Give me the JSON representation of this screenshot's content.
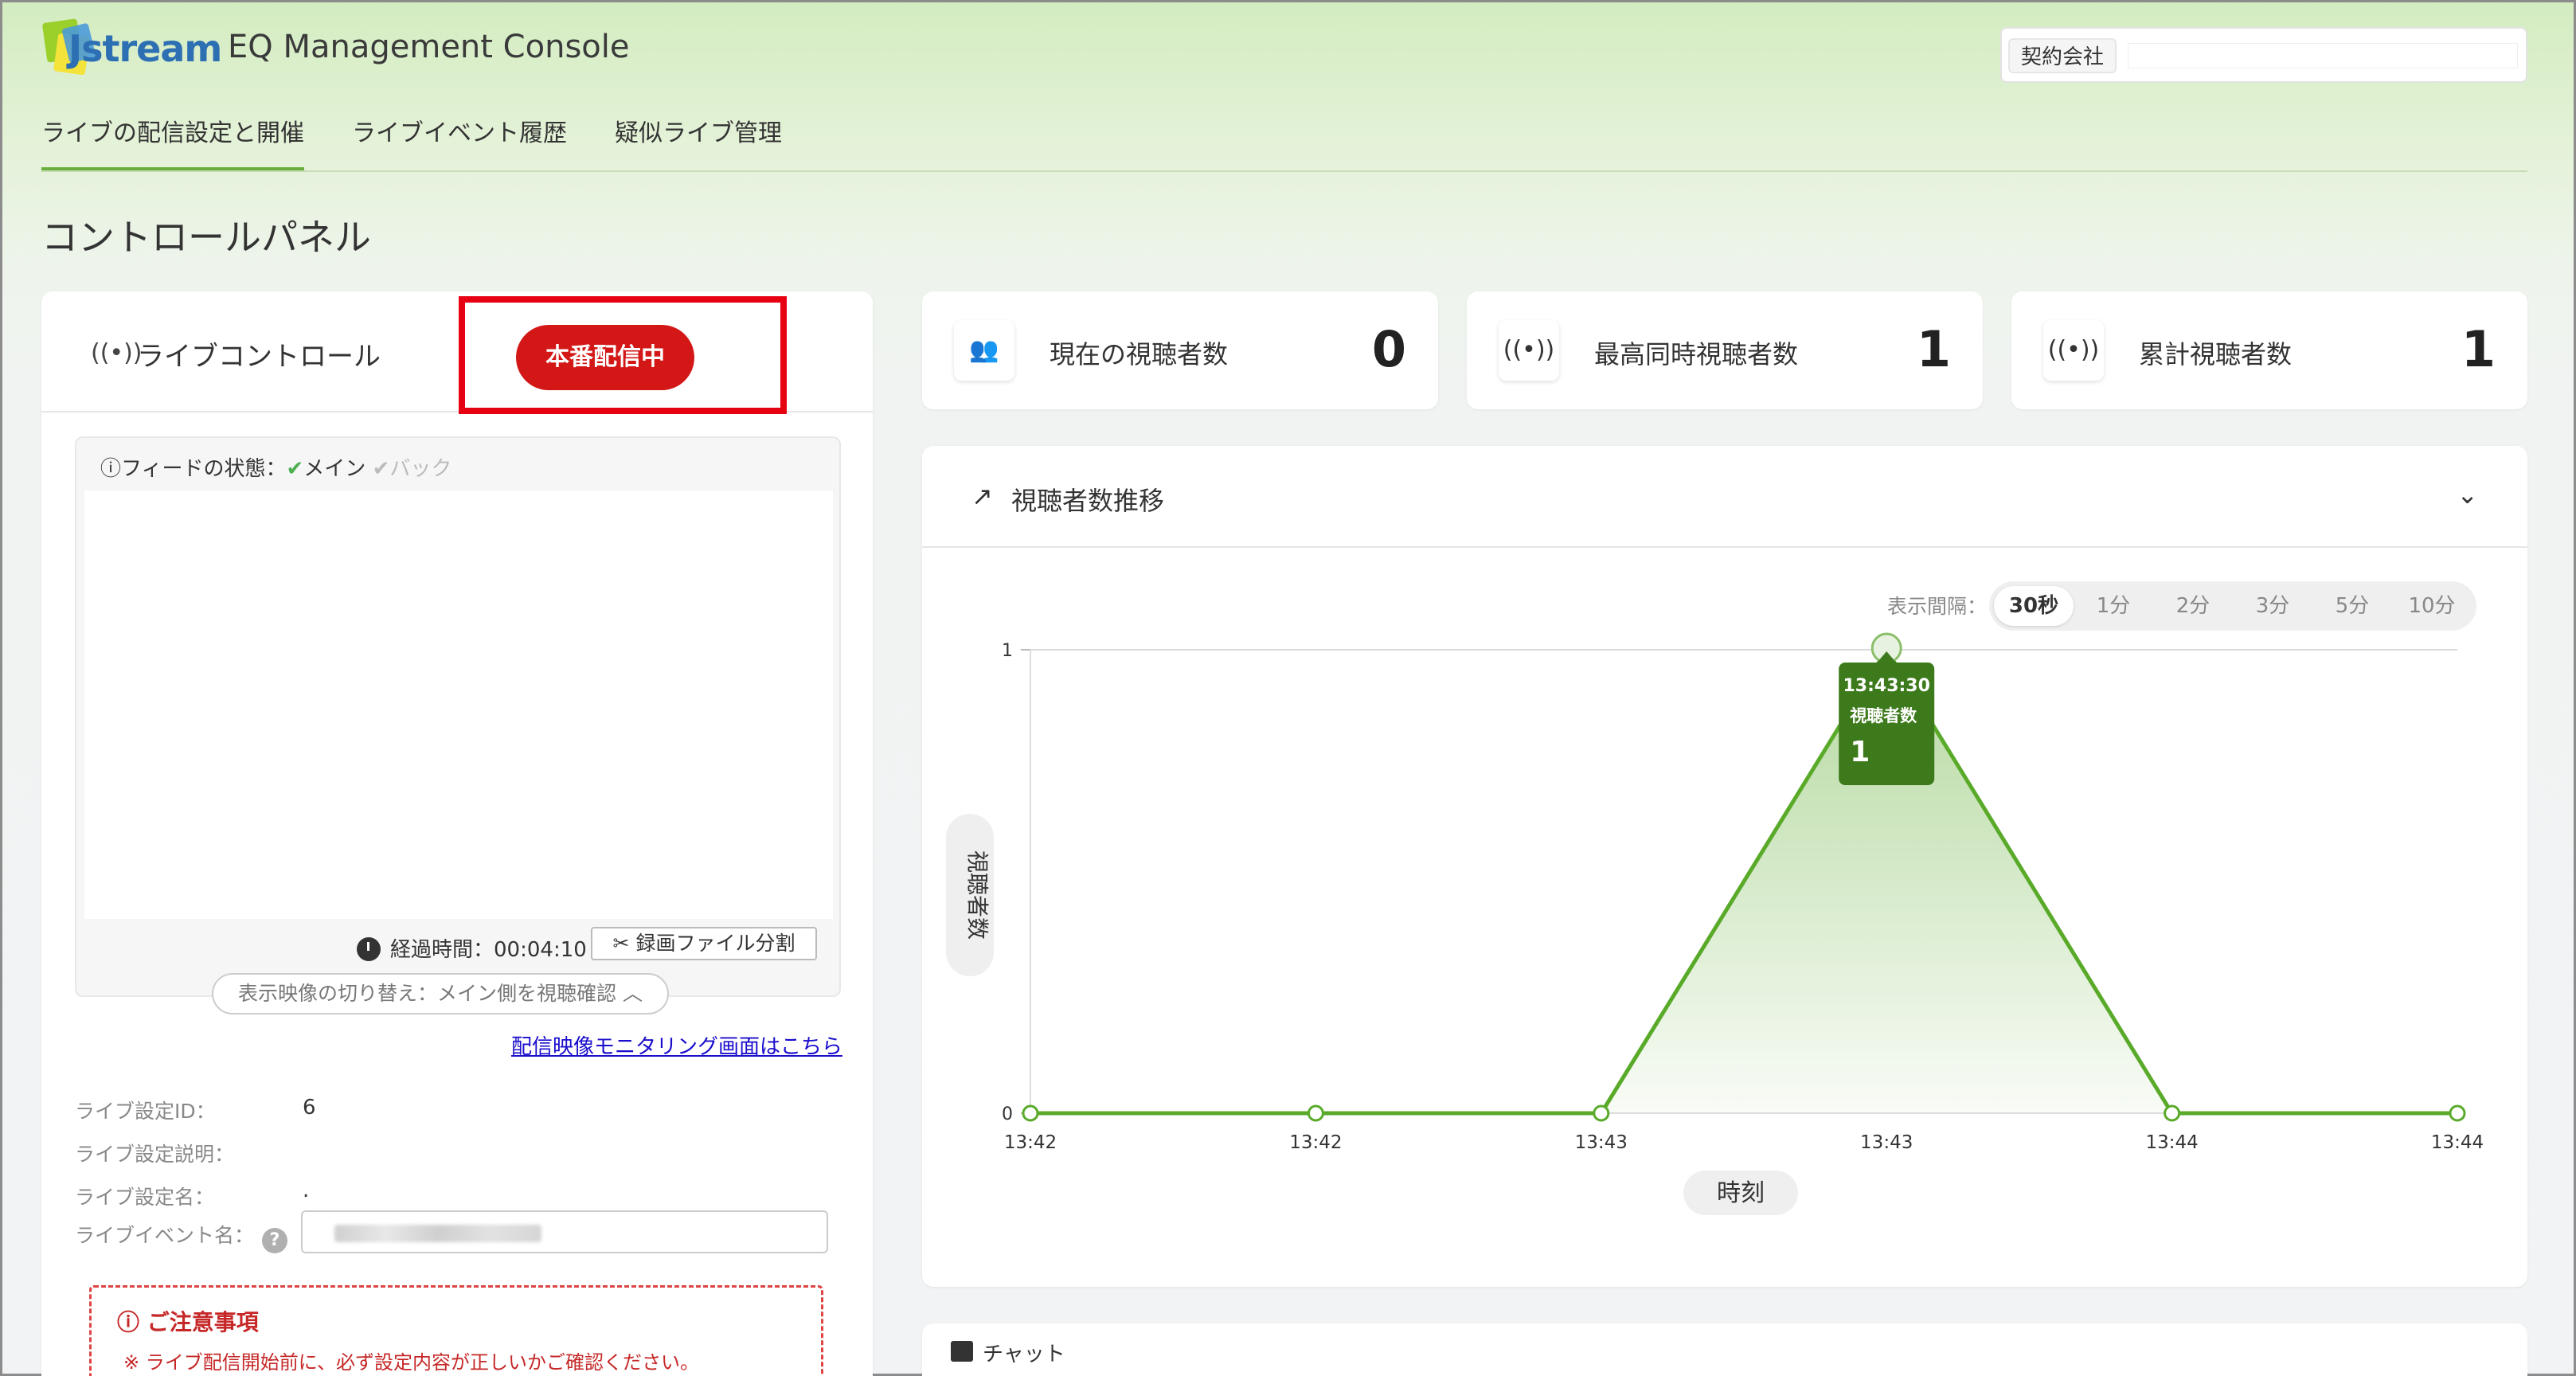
{
  "header": {
    "logo_text": "Jstream",
    "app_title": "EQ Management Console",
    "company_label": "契約会社",
    "company_value": ""
  },
  "nav": {
    "items": [
      {
        "label": "ライブの配信設定と開催",
        "active": true
      },
      {
        "label": "ライブイベント履歴",
        "active": false
      },
      {
        "label": "疑似ライブ管理",
        "active": false
      }
    ]
  },
  "page_title": "コントロールパネル",
  "live_control": {
    "title": "ライブコントロール",
    "live_button": "本番配信中",
    "feed_status_label": "フィードの状態：",
    "feed_main": "メイン",
    "feed_back": "バック",
    "elapsed_label": "経過時間：",
    "elapsed_value": "00:04:10",
    "split_button": "録画ファイル分割",
    "switch_label": "表示映像の切り替え：メイン側を視聴確認",
    "monitor_link": "配信映像モニタリング画面はこちら",
    "fields": [
      {
        "label": "ライブ設定ID：",
        "value": "6"
      },
      {
        "label": "ライブ設定説明：",
        "value": ""
      },
      {
        "label": "ライブ設定名：",
        "value": "."
      },
      {
        "label": "ライブイベント名：",
        "value": ""
      }
    ],
    "notice_title": "ご注意事項",
    "notice_text": "※ ライブ配信開始前に、必ず設定内容が正しいかご確認ください。"
  },
  "stats": [
    {
      "label": "現在の視聴者数",
      "value": "0",
      "icon": "people-icon"
    },
    {
      "label": "最高同時視聴者数",
      "value": "1",
      "icon": "broadcast-icon"
    },
    {
      "label": "累計視聴者数",
      "value": "1",
      "icon": "broadcast-icon"
    }
  ],
  "viewer_chart": {
    "title": "視聴者数推移",
    "interval_label": "表示間隔：",
    "intervals": [
      "30秒",
      "1分",
      "2分",
      "3分",
      "5分",
      "10分"
    ],
    "selected_interval": "30秒",
    "tooltip": {
      "time": "13:43:30",
      "label": "視聴者数",
      "value": "1"
    }
  },
  "chart_data": {
    "type": "area",
    "categories": [
      "13:42",
      "13:42",
      "13:43",
      "13:43",
      "13:44",
      "13:44"
    ],
    "series": [
      {
        "values": [
          0,
          0,
          0,
          1,
          0,
          0
        ]
      }
    ],
    "xlabel": "時刻",
    "ylabel": "視聴者数",
    "ylim": [
      0,
      1
    ],
    "y_ticks": [
      "0",
      "1"
    ],
    "colors": {
      "line": "#5aaa2a",
      "tooltip": "#3d7a1c"
    },
    "grid": true
  },
  "chat": {
    "title": "チャット"
  }
}
